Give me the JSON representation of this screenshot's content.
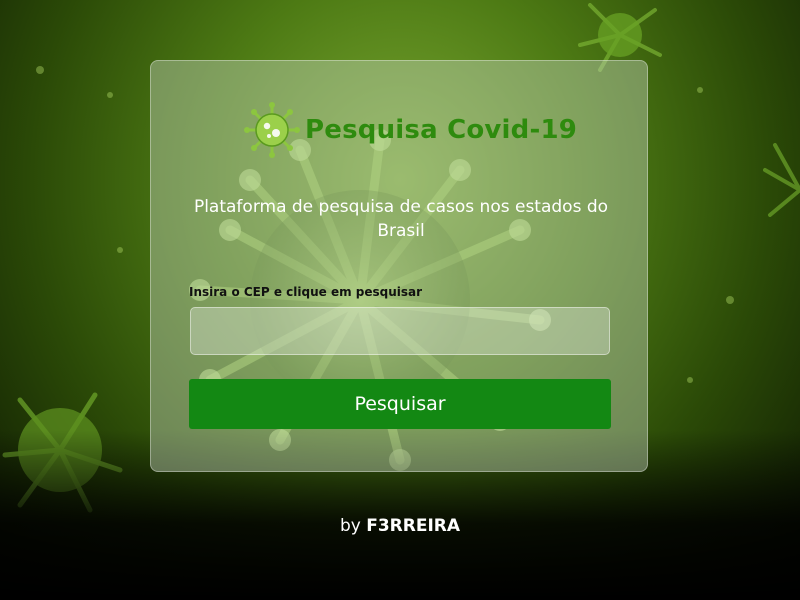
{
  "app": {
    "title": "Pesquisa Covid-19",
    "logo_icon": "virus-icon",
    "subtitle": "Plataforma de pesquisa de casos nos estados do Brasil"
  },
  "form": {
    "label": "Insira o CEP e clique em pesquisar",
    "cep_value": "",
    "cep_placeholder": "",
    "button_label": "Pesquisar"
  },
  "footer": {
    "prefix": "by",
    "author": "F3RREIRA"
  },
  "colors": {
    "accent": "#138813",
    "title_green": "#2e8b0e",
    "background_green": "#4d7a14"
  }
}
